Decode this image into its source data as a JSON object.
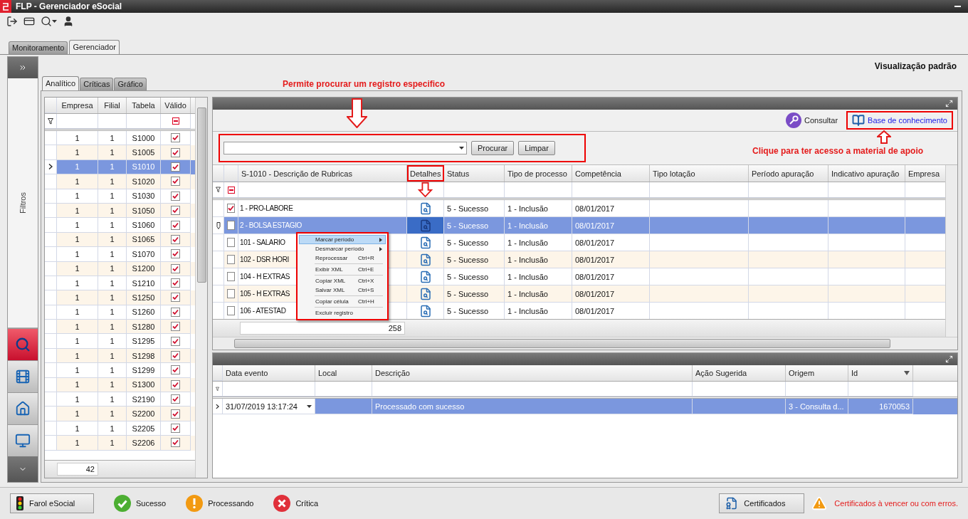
{
  "window": {
    "title": "FLP - Gerenciador eSocial"
  },
  "main_tabs": [
    {
      "label": "Monitoramento",
      "selected": false
    },
    {
      "label": "Gerenciador",
      "selected": true
    }
  ],
  "sidebar": {
    "label": "Filtros",
    "items": [
      {
        "kind": "search",
        "selected": true
      },
      {
        "kind": "film",
        "selected": false
      },
      {
        "kind": "home",
        "selected": false
      },
      {
        "kind": "monitor",
        "selected": false
      }
    ]
  },
  "view_title": "Visualização padrão",
  "sub_tabs": [
    {
      "label": "Analítico",
      "selected": true
    },
    {
      "label": "Críticas",
      "selected": false
    },
    {
      "label": "Gráfico",
      "selected": false
    }
  ],
  "annotations": {
    "search_hint": "Permite procurar um registro especifico",
    "help_hint": "Clique para ter acesso a material de apoio"
  },
  "table_list": {
    "columns": [
      "Empresa",
      "Filial",
      "Tabela",
      "Válido"
    ],
    "footer": "42",
    "rows": [
      {
        "empresa": "1",
        "filial": "1",
        "tabela": "S1000",
        "valid": true,
        "selected": false
      },
      {
        "empresa": "1",
        "filial": "1",
        "tabela": "S1005",
        "valid": true,
        "selected": false
      },
      {
        "empresa": "1",
        "filial": "1",
        "tabela": "S1010",
        "valid": true,
        "selected": true
      },
      {
        "empresa": "1",
        "filial": "1",
        "tabela": "S1020",
        "valid": true,
        "selected": false
      },
      {
        "empresa": "1",
        "filial": "1",
        "tabela": "S1030",
        "valid": true,
        "selected": false
      },
      {
        "empresa": "1",
        "filial": "1",
        "tabela": "S1050",
        "valid": true,
        "selected": false
      },
      {
        "empresa": "1",
        "filial": "1",
        "tabela": "S1060",
        "valid": true,
        "selected": false
      },
      {
        "empresa": "1",
        "filial": "1",
        "tabela": "S1065",
        "valid": true,
        "selected": false
      },
      {
        "empresa": "1",
        "filial": "1",
        "tabela": "S1070",
        "valid": true,
        "selected": false
      },
      {
        "empresa": "1",
        "filial": "1",
        "tabela": "S1200",
        "valid": true,
        "selected": false
      },
      {
        "empresa": "1",
        "filial": "1",
        "tabela": "S1210",
        "valid": true,
        "selected": false
      },
      {
        "empresa": "1",
        "filial": "1",
        "tabela": "S1250",
        "valid": true,
        "selected": false
      },
      {
        "empresa": "1",
        "filial": "1",
        "tabela": "S1260",
        "valid": true,
        "selected": false
      },
      {
        "empresa": "1",
        "filial": "1",
        "tabela": "S1280",
        "valid": true,
        "selected": false
      },
      {
        "empresa": "1",
        "filial": "1",
        "tabela": "S1295",
        "valid": true,
        "selected": false
      },
      {
        "empresa": "1",
        "filial": "1",
        "tabela": "S1298",
        "valid": true,
        "selected": false
      },
      {
        "empresa": "1",
        "filial": "1",
        "tabela": "S1299",
        "valid": true,
        "selected": false
      },
      {
        "empresa": "1",
        "filial": "1",
        "tabela": "S1300",
        "valid": true,
        "selected": false
      },
      {
        "empresa": "1",
        "filial": "1",
        "tabela": "S2190",
        "valid": true,
        "selected": false
      },
      {
        "empresa": "1",
        "filial": "1",
        "tabela": "S2200",
        "valid": true,
        "selected": false
      },
      {
        "empresa": "1",
        "filial": "1",
        "tabela": "S2205",
        "valid": true,
        "selected": false
      },
      {
        "empresa": "1",
        "filial": "1",
        "tabela": "S2206",
        "valid": true,
        "selected": false
      }
    ]
  },
  "actions": {
    "consult": "Consultar",
    "knowledge": "Base de conhecimento"
  },
  "search": {
    "buttons": [
      "Procurar",
      "Limpar"
    ]
  },
  "records": {
    "columns": [
      "S-1010 - Descrição de Rubricas",
      "Detalhes",
      "Status",
      "Tipo de processo",
      "Competência",
      "Tipo lotação",
      "Período apuração",
      "Indicativo apuração",
      "Empresa"
    ],
    "footer": "258",
    "rows": [
      {
        "checked": true,
        "selected": false,
        "description": "1 - PRO-LABORE",
        "status": "5 - Sucesso",
        "process_type": "1 - Inclusão",
        "competence": "08/01/2017"
      },
      {
        "checked": false,
        "selected": true,
        "description": "2 - BOLSA ESTAGIO",
        "status": "5 - Sucesso",
        "process_type": "1 - Inclusão",
        "competence": "08/01/2017"
      },
      {
        "checked": false,
        "selected": false,
        "description": "101 - SALARIO",
        "status": "5 - Sucesso",
        "process_type": "1 - Inclusão",
        "competence": "08/01/2017"
      },
      {
        "checked": false,
        "selected": false,
        "description": "102 - DSR HORI",
        "status": "5 - Sucesso",
        "process_type": "1 - Inclusão",
        "competence": "08/01/2017"
      },
      {
        "checked": false,
        "selected": false,
        "description": "104 - H EXTRAS",
        "status": "5 - Sucesso",
        "process_type": "1 - Inclusão",
        "competence": "08/01/2017"
      },
      {
        "checked": false,
        "selected": false,
        "description": "105 - H EXTRAS",
        "status": "5 - Sucesso",
        "process_type": "1 - Inclusão",
        "competence": "08/01/2017"
      },
      {
        "checked": false,
        "selected": false,
        "description": "106 - ATESTAD",
        "status": "5 - Sucesso",
        "process_type": "1 - Inclusão",
        "competence": "08/01/2017"
      }
    ]
  },
  "context_menu": {
    "groups": [
      [
        {
          "label": "Marcar período",
          "submenu": true,
          "selected": true
        },
        {
          "label": "Desmarcar período",
          "submenu": true,
          "selected": false
        },
        {
          "label": "Reprocessar",
          "shortcut": "Ctrl+R",
          "submenu": false,
          "selected": false
        }
      ],
      [
        {
          "label": "Exibir XML",
          "shortcut": "Ctrl+E",
          "submenu": false,
          "selected": false
        }
      ],
      [
        {
          "label": "Copiar XML",
          "shortcut": "Ctrl+X",
          "submenu": false,
          "selected": false
        },
        {
          "label": "Salvar XML",
          "shortcut": "Ctrl+S",
          "submenu": false,
          "selected": false
        }
      ],
      [
        {
          "label": "Copiar célula",
          "shortcut": "Ctrl+H",
          "submenu": false,
          "selected": false
        }
      ],
      [
        {
          "label": "Excluir registro",
          "submenu": false,
          "selected": false
        }
      ]
    ]
  },
  "events": {
    "columns": [
      "Data evento",
      "Local",
      "Descrição",
      "Ação Sugerida",
      "Origem",
      "Id"
    ],
    "rows": [
      {
        "date": "31/07/2019 13:17:24",
        "description": "Processado com sucesso",
        "origin": "3 - Consulta d...",
        "id": "1670053",
        "selected": true
      }
    ]
  },
  "status_bar": {
    "farol": "Farol eSocial",
    "legend": [
      {
        "kind": "success",
        "label": "Sucesso"
      },
      {
        "kind": "processing",
        "label": "Processando"
      },
      {
        "kind": "critical",
        "label": "Crítica"
      }
    ],
    "certificates": "Certificados",
    "warning": "Certificados à vencer ou com erros."
  }
}
